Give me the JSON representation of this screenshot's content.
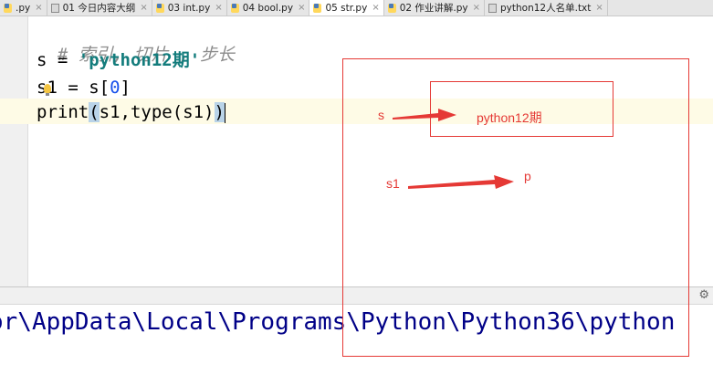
{
  "tabs": [
    {
      "label": ".py",
      "icon": "python-file-icon",
      "active": false
    },
    {
      "label": "01 今日内容大纲",
      "icon": "text-file-icon",
      "active": false
    },
    {
      "label": "03 int.py",
      "icon": "python-file-icon",
      "active": false
    },
    {
      "label": "04 bool.py",
      "icon": "python-file-icon",
      "active": false
    },
    {
      "label": "05 str.py",
      "icon": "python-file-icon",
      "active": true
    },
    {
      "label": "02 作业讲解.py",
      "icon": "python-file-icon",
      "active": false
    },
    {
      "label": "python12人名单.txt",
      "icon": "text-file-icon",
      "active": false
    }
  ],
  "tab_close_glyph": "×",
  "code": {
    "line1": "# 索引, 切片 , 步长",
    "line2_a": "s = ",
    "line2_b": "'python12期'",
    "line3_a": "s1 = s[",
    "line3_b": "0",
    "line3_c": "]",
    "line4_a": "print",
    "line4_b": "(",
    "line4_c": "s1,type(s1)",
    "line4_d": ")"
  },
  "console": {
    "path": "or\\AppData\\Local\\Programs\\Python\\Python36\\python"
  },
  "annotations": {
    "s_label": "s",
    "s_value": "python12期",
    "s1_label": "s1",
    "s1_value": "p"
  },
  "colors": {
    "annotation": "#e53935",
    "string": "#137c7c",
    "number": "#1750eb",
    "comment": "#8c8c8c",
    "console_text": "#000087",
    "current_line": "#fefbe6"
  }
}
